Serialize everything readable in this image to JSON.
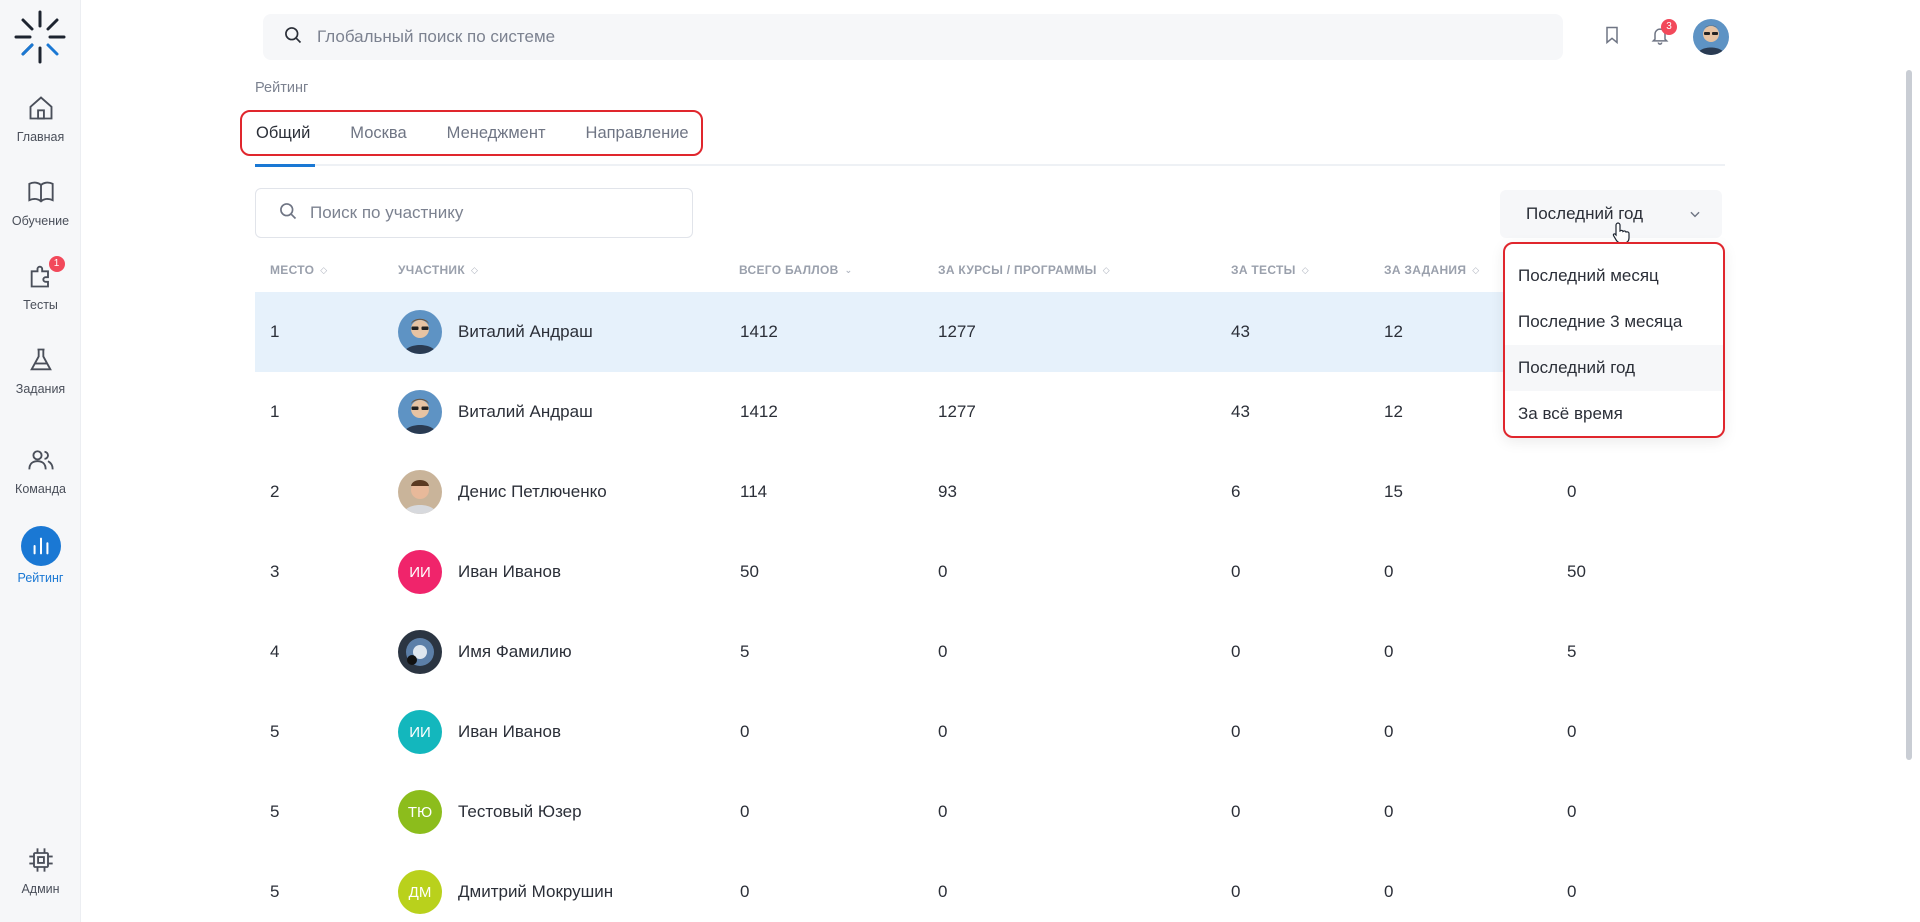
{
  "sidebar": {
    "items": [
      {
        "label": "Главная",
        "icon": "home-icon"
      },
      {
        "label": "Обучение",
        "icon": "book-icon"
      },
      {
        "label": "Тесты",
        "icon": "puzzle-icon",
        "badge": "1"
      },
      {
        "label": "Задания",
        "icon": "flask-icon"
      },
      {
        "label": "Команда",
        "icon": "team-icon"
      },
      {
        "label": "Рейтинг",
        "icon": "chart-icon",
        "active": true
      }
    ],
    "admin_label": "Админ"
  },
  "header": {
    "search_placeholder": "Глобальный поиск по системе",
    "notifications_count": "3"
  },
  "page": {
    "breadcrumb": "Рейтинг",
    "tabs": [
      {
        "label": "Общий",
        "active": true
      },
      {
        "label": "Москва"
      },
      {
        "label": "Менеджмент"
      },
      {
        "label": "Направление"
      }
    ],
    "participant_search_placeholder": "Поиск по участнику",
    "period": {
      "selected": "Последний год",
      "options": [
        "Последний месяц",
        "Последние 3 месяца",
        "Последний год",
        "За всё время"
      ]
    }
  },
  "table": {
    "columns": [
      "МЕСТО",
      "УЧАСТНИК",
      "ВСЕГО БАЛЛОВ",
      "ЗА КУРСЫ / ПРОГРАММЫ",
      "ЗА ТЕСТЫ",
      "ЗА ЗАДАНИЯ"
    ],
    "rows": [
      {
        "place": "1",
        "name": "Виталий Андраш",
        "initials": "",
        "color": "photo-blue",
        "total": "1412",
        "courses": "1277",
        "tests": "43",
        "tasks": "12",
        "extra": ""
      },
      {
        "place": "1",
        "name": "Виталий Андраш",
        "initials": "",
        "color": "photo-blue",
        "total": "1412",
        "courses": "1277",
        "tests": "43",
        "tasks": "12",
        "extra": ""
      },
      {
        "place": "2",
        "name": "Денис Петлюченко",
        "initials": "",
        "color": "photo-warm",
        "total": "114",
        "courses": "93",
        "tests": "6",
        "tasks": "15",
        "extra": "0"
      },
      {
        "place": "3",
        "name": "Иван Иванов",
        "initials": "ИИ",
        "color": "#f0246b",
        "total": "50",
        "courses": "0",
        "tests": "0",
        "tasks": "0",
        "extra": "50"
      },
      {
        "place": "4",
        "name": "Имя Фамилию",
        "initials": "",
        "color": "photo-dark",
        "total": "5",
        "courses": "0",
        "tests": "0",
        "tasks": "0",
        "extra": "5"
      },
      {
        "place": "5",
        "name": "Иван Иванов",
        "initials": "ИИ",
        "color": "#13b7bd",
        "total": "0",
        "courses": "0",
        "tests": "0",
        "tasks": "0",
        "extra": "0"
      },
      {
        "place": "5",
        "name": "Тестовый Юзер",
        "initials": "ТЮ",
        "color": "#8cbd1c",
        "total": "0",
        "courses": "0",
        "tests": "0",
        "tasks": "0",
        "extra": "0"
      },
      {
        "place": "5",
        "name": "Дмитрий Мокрушин",
        "initials": "ДМ",
        "color": "#b9d11c",
        "total": "0",
        "courses": "0",
        "tests": "0",
        "tasks": "0",
        "extra": "0"
      }
    ]
  },
  "colors": {
    "accent": "#1a78d4",
    "highlight_border": "#e0262d",
    "row_highlight": "#e6f1fb"
  }
}
